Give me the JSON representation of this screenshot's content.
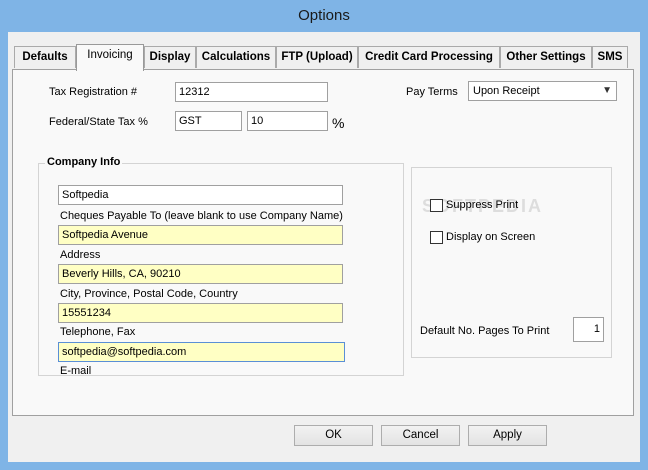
{
  "window": {
    "title": "Options"
  },
  "tabs": [
    {
      "label": "Defaults",
      "active": false
    },
    {
      "label": "Invoicing",
      "active": true
    },
    {
      "label": "Display",
      "active": false
    },
    {
      "label": "Calculations",
      "active": false
    },
    {
      "label": "FTP (Upload)",
      "active": false
    },
    {
      "label": "Credit Card Processing",
      "active": false
    },
    {
      "label": "Other Settings",
      "active": false
    },
    {
      "label": "SMS",
      "active": false
    }
  ],
  "invoicing": {
    "tax_registration": {
      "label": "Tax Registration #",
      "value": "12312"
    },
    "federal_state_tax": {
      "label": "Federal/State Tax %",
      "name_value": "GST",
      "rate_value": "10",
      "percent_sign": "%"
    },
    "pay_terms": {
      "label": "Pay Terms",
      "selected": "Upon Receipt"
    },
    "company_info": {
      "title": "Company Info",
      "cheques_payable": {
        "value": "Softpedia",
        "caption": "Cheques Payable To (leave blank to use Company Name)"
      },
      "address": {
        "value": "Softpedia Avenue",
        "caption": "Address"
      },
      "city": {
        "value": "Beverly Hills, CA, 90210",
        "caption": "City, Province, Postal Code, Country"
      },
      "telephone": {
        "value": "15551234",
        "caption": "Telephone, Fax"
      },
      "email": {
        "value": "softpedia@softpedia.com",
        "caption": "E-mail"
      }
    },
    "print_options": {
      "suppress_print": {
        "label": "Suppress Print",
        "checked": false
      },
      "display_on_screen": {
        "label": "Display on Screen",
        "checked": false
      },
      "default_pages": {
        "label": "Default No. Pages To Print",
        "value": "1"
      }
    }
  },
  "watermark": "SOFTPEDIA",
  "buttons": {
    "ok": "OK",
    "cancel": "Cancel",
    "apply": "Apply"
  }
}
